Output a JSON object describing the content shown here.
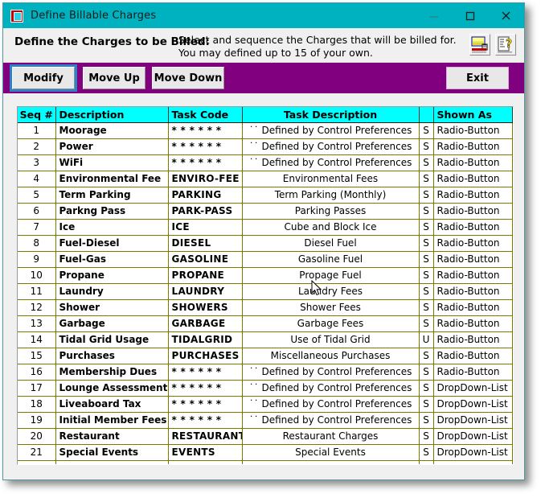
{
  "window": {
    "title": "Define Billable Charges",
    "icon": "app-window-icon",
    "controls": {
      "minimize": "minimize-icon",
      "maximize": "maximize-icon",
      "close": "close-icon"
    },
    "colors": {
      "titlebar": "#00b2bf",
      "toolbar": "#800080",
      "grid_header": "#00ffff",
      "grid_line": "#7a7a00",
      "focus_outline": "#2e81c4"
    }
  },
  "instruction": {
    "title": "Define the Charges to be Billed:",
    "line1": "Select and sequence the Charges that will be billed for.",
    "line2": "You may defined up to 15 of your own.",
    "report_icon": "report-print-icon",
    "help_icon": "help-question-icon"
  },
  "toolbar": {
    "modify_label": "Modify",
    "move_up_label": "Move Up",
    "move_down_label": "Move Down",
    "exit_label": "Exit"
  },
  "grid": {
    "columns": [
      "Seq #",
      "Description",
      "Task Code",
      "Task Description",
      "",
      "Shown As"
    ],
    "rows": [
      {
        "seq": "1",
        "description": "Moorage",
        "task_code": "* * * * * *",
        "task_description": "˙˙ Defined by Control Preferences",
        "flag": "S",
        "shown_as": "Radio-Button"
      },
      {
        "seq": "2",
        "description": "Power",
        "task_code": "* * * * * *",
        "task_description": "˙˙ Defined by Control Preferences",
        "flag": "S",
        "shown_as": "Radio-Button"
      },
      {
        "seq": "3",
        "description": "WiFi",
        "task_code": "* * * * * *",
        "task_description": "˙˙ Defined by Control Preferences",
        "flag": "S",
        "shown_as": "Radio-Button"
      },
      {
        "seq": "4",
        "description": "Environmental Fee",
        "task_code": "ENVIRO-FEE",
        "task_description": "Environmental Fees",
        "flag": "S",
        "shown_as": "Radio-Button"
      },
      {
        "seq": "5",
        "description": "Term Parking",
        "task_code": "PARKING",
        "task_description": "Term Parking (Monthly)",
        "flag": "S",
        "shown_as": "Radio-Button"
      },
      {
        "seq": "6",
        "description": "Parkng Pass",
        "task_code": "PARK-PASS",
        "task_description": "Parking Passes",
        "flag": "S",
        "shown_as": "Radio-Button"
      },
      {
        "seq": "7",
        "description": "Ice",
        "task_code": "ICE",
        "task_description": "Cube and Block Ice",
        "flag": "S",
        "shown_as": "Radio-Button"
      },
      {
        "seq": "8",
        "description": "Fuel-Diesel",
        "task_code": "DIESEL",
        "task_description": "Diesel Fuel",
        "flag": "S",
        "shown_as": "Radio-Button"
      },
      {
        "seq": "9",
        "description": "Fuel-Gas",
        "task_code": "GASOLINE",
        "task_description": "Gasoline Fuel",
        "flag": "S",
        "shown_as": "Radio-Button"
      },
      {
        "seq": "10",
        "description": "Propane",
        "task_code": "PROPANE",
        "task_description": "Propage Fuel",
        "flag": "S",
        "shown_as": "Radio-Button"
      },
      {
        "seq": "11",
        "description": "Laundry",
        "task_code": "LAUNDRY",
        "task_description": "Laundry Fees",
        "flag": "S",
        "shown_as": "Radio-Button"
      },
      {
        "seq": "12",
        "description": "Shower",
        "task_code": "SHOWERS",
        "task_description": "Shower Fees",
        "flag": "S",
        "shown_as": "Radio-Button"
      },
      {
        "seq": "13",
        "description": "Garbage",
        "task_code": "GARBAGE",
        "task_description": "Garbage Fees",
        "flag": "S",
        "shown_as": "Radio-Button"
      },
      {
        "seq": "14",
        "description": "Tidal Grid Usage",
        "task_code": "TIDALGRID",
        "task_description": "Use of Tidal Grid",
        "flag": "U",
        "shown_as": "Radio-Button"
      },
      {
        "seq": "15",
        "description": "Purchases",
        "task_code": "PURCHASES",
        "task_description": "Miscellaneous Purchases",
        "flag": "S",
        "shown_as": "Radio-Button"
      },
      {
        "seq": "16",
        "description": "Membership Dues",
        "task_code": "* * * * * *",
        "task_description": "˙˙ Defined by Control Preferences",
        "flag": "S",
        "shown_as": "Radio-Button"
      },
      {
        "seq": "17",
        "description": "Lounge Assessment",
        "task_code": "* * * * * *",
        "task_description": "˙˙ Defined by Control Preferences",
        "flag": "S",
        "shown_as": "DropDown-List"
      },
      {
        "seq": "18",
        "description": "Liveaboard Tax",
        "task_code": "* * * * * *",
        "task_description": "˙˙ Defined by Control Preferences",
        "flag": "S",
        "shown_as": "DropDown-List"
      },
      {
        "seq": "19",
        "description": "Initial Member Fees",
        "task_code": "* * * * * *",
        "task_description": "˙˙ Defined by Control Preferences",
        "flag": "S",
        "shown_as": "DropDown-List"
      },
      {
        "seq": "20",
        "description": "Restaurant",
        "task_code": "RESTAURANT",
        "task_description": "Restaurant Charges",
        "flag": "S",
        "shown_as": "DropDown-List"
      },
      {
        "seq": "21",
        "description": "Special Events",
        "task_code": "EVENTS",
        "task_description": "Special Events",
        "flag": "S",
        "shown_as": "DropDown-List"
      },
      {
        "seq": "",
        "description": "",
        "task_code": "",
        "task_description": "",
        "flag": "",
        "shown_as": ""
      }
    ]
  }
}
